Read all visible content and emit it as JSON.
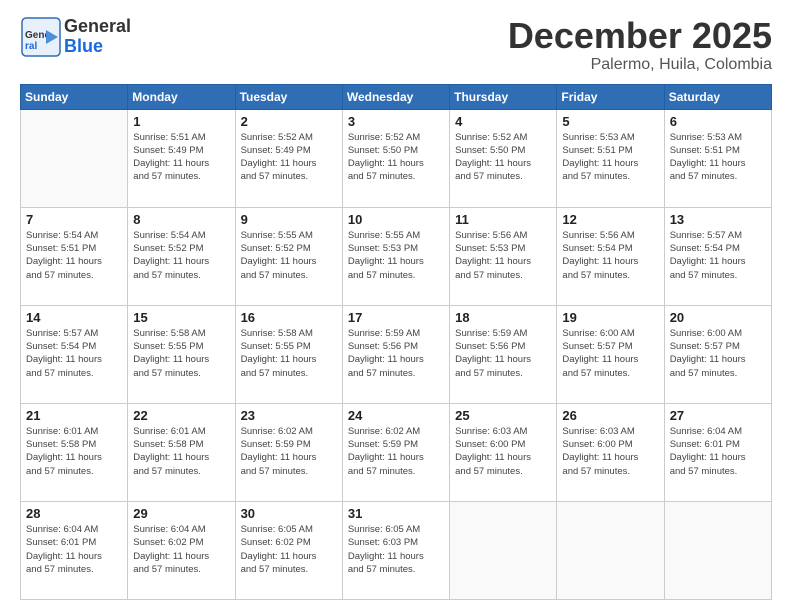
{
  "header": {
    "logo": {
      "general": "General",
      "blue": "Blue"
    },
    "month": "December 2025",
    "location": "Palermo, Huila, Colombia"
  },
  "weekdays": [
    "Sunday",
    "Monday",
    "Tuesday",
    "Wednesday",
    "Thursday",
    "Friday",
    "Saturday"
  ],
  "weeks": [
    [
      {
        "day": "",
        "info": ""
      },
      {
        "day": "1",
        "info": "Sunrise: 5:51 AM\nSunset: 5:49 PM\nDaylight: 11 hours\nand 57 minutes."
      },
      {
        "day": "2",
        "info": "Sunrise: 5:52 AM\nSunset: 5:49 PM\nDaylight: 11 hours\nand 57 minutes."
      },
      {
        "day": "3",
        "info": "Sunrise: 5:52 AM\nSunset: 5:50 PM\nDaylight: 11 hours\nand 57 minutes."
      },
      {
        "day": "4",
        "info": "Sunrise: 5:52 AM\nSunset: 5:50 PM\nDaylight: 11 hours\nand 57 minutes."
      },
      {
        "day": "5",
        "info": "Sunrise: 5:53 AM\nSunset: 5:51 PM\nDaylight: 11 hours\nand 57 minutes."
      },
      {
        "day": "6",
        "info": "Sunrise: 5:53 AM\nSunset: 5:51 PM\nDaylight: 11 hours\nand 57 minutes."
      }
    ],
    [
      {
        "day": "7",
        "info": "Sunrise: 5:54 AM\nSunset: 5:51 PM\nDaylight: 11 hours\nand 57 minutes."
      },
      {
        "day": "8",
        "info": "Sunrise: 5:54 AM\nSunset: 5:52 PM\nDaylight: 11 hours\nand 57 minutes."
      },
      {
        "day": "9",
        "info": "Sunrise: 5:55 AM\nSunset: 5:52 PM\nDaylight: 11 hours\nand 57 minutes."
      },
      {
        "day": "10",
        "info": "Sunrise: 5:55 AM\nSunset: 5:53 PM\nDaylight: 11 hours\nand 57 minutes."
      },
      {
        "day": "11",
        "info": "Sunrise: 5:56 AM\nSunset: 5:53 PM\nDaylight: 11 hours\nand 57 minutes."
      },
      {
        "day": "12",
        "info": "Sunrise: 5:56 AM\nSunset: 5:54 PM\nDaylight: 11 hours\nand 57 minutes."
      },
      {
        "day": "13",
        "info": "Sunrise: 5:57 AM\nSunset: 5:54 PM\nDaylight: 11 hours\nand 57 minutes."
      }
    ],
    [
      {
        "day": "14",
        "info": "Sunrise: 5:57 AM\nSunset: 5:54 PM\nDaylight: 11 hours\nand 57 minutes."
      },
      {
        "day": "15",
        "info": "Sunrise: 5:58 AM\nSunset: 5:55 PM\nDaylight: 11 hours\nand 57 minutes."
      },
      {
        "day": "16",
        "info": "Sunrise: 5:58 AM\nSunset: 5:55 PM\nDaylight: 11 hours\nand 57 minutes."
      },
      {
        "day": "17",
        "info": "Sunrise: 5:59 AM\nSunset: 5:56 PM\nDaylight: 11 hours\nand 57 minutes."
      },
      {
        "day": "18",
        "info": "Sunrise: 5:59 AM\nSunset: 5:56 PM\nDaylight: 11 hours\nand 57 minutes."
      },
      {
        "day": "19",
        "info": "Sunrise: 6:00 AM\nSunset: 5:57 PM\nDaylight: 11 hours\nand 57 minutes."
      },
      {
        "day": "20",
        "info": "Sunrise: 6:00 AM\nSunset: 5:57 PM\nDaylight: 11 hours\nand 57 minutes."
      }
    ],
    [
      {
        "day": "21",
        "info": "Sunrise: 6:01 AM\nSunset: 5:58 PM\nDaylight: 11 hours\nand 57 minutes."
      },
      {
        "day": "22",
        "info": "Sunrise: 6:01 AM\nSunset: 5:58 PM\nDaylight: 11 hours\nand 57 minutes."
      },
      {
        "day": "23",
        "info": "Sunrise: 6:02 AM\nSunset: 5:59 PM\nDaylight: 11 hours\nand 57 minutes."
      },
      {
        "day": "24",
        "info": "Sunrise: 6:02 AM\nSunset: 5:59 PM\nDaylight: 11 hours\nand 57 minutes."
      },
      {
        "day": "25",
        "info": "Sunrise: 6:03 AM\nSunset: 6:00 PM\nDaylight: 11 hours\nand 57 minutes."
      },
      {
        "day": "26",
        "info": "Sunrise: 6:03 AM\nSunset: 6:00 PM\nDaylight: 11 hours\nand 57 minutes."
      },
      {
        "day": "27",
        "info": "Sunrise: 6:04 AM\nSunset: 6:01 PM\nDaylight: 11 hours\nand 57 minutes."
      }
    ],
    [
      {
        "day": "28",
        "info": "Sunrise: 6:04 AM\nSunset: 6:01 PM\nDaylight: 11 hours\nand 57 minutes."
      },
      {
        "day": "29",
        "info": "Sunrise: 6:04 AM\nSunset: 6:02 PM\nDaylight: 11 hours\nand 57 minutes."
      },
      {
        "day": "30",
        "info": "Sunrise: 6:05 AM\nSunset: 6:02 PM\nDaylight: 11 hours\nand 57 minutes."
      },
      {
        "day": "31",
        "info": "Sunrise: 6:05 AM\nSunset: 6:03 PM\nDaylight: 11 hours\nand 57 minutes."
      },
      {
        "day": "",
        "info": ""
      },
      {
        "day": "",
        "info": ""
      },
      {
        "day": "",
        "info": ""
      }
    ]
  ]
}
